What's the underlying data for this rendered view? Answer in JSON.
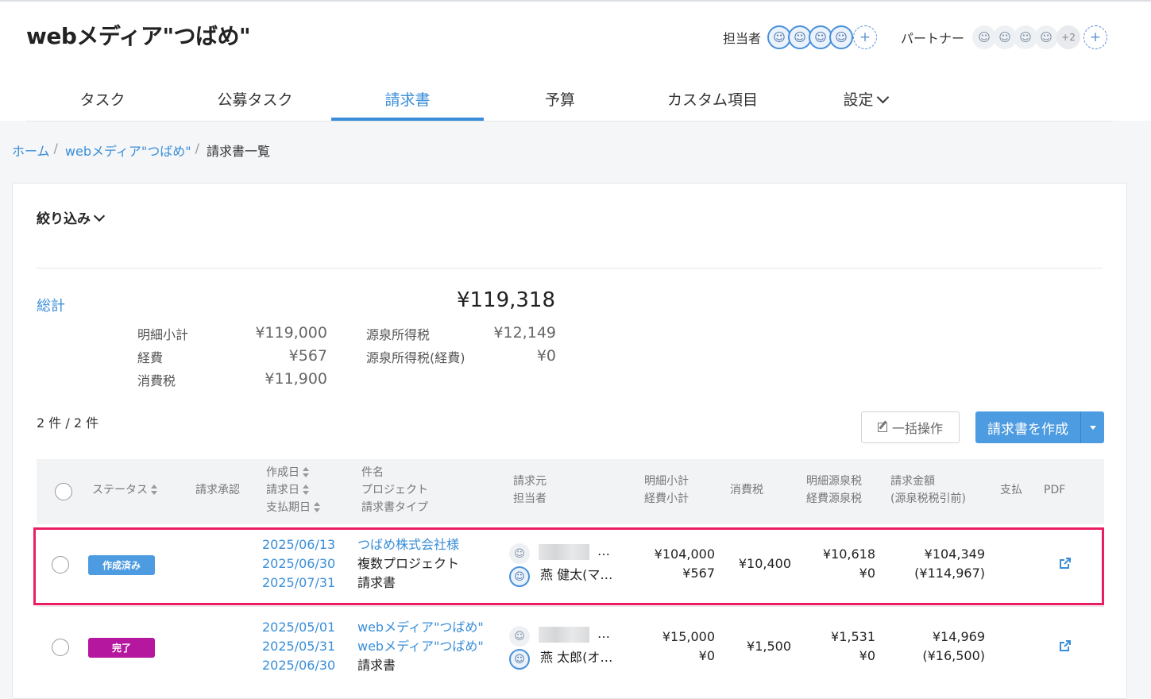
{
  "app": {
    "title": "webメディア\"つばめ\""
  },
  "team": {
    "members_label": "担当者",
    "partners_label": "パートナー",
    "member_avatars": [
      "☺",
      "☺",
      "☺",
      "☺"
    ],
    "partner_avatars": [
      "☺",
      "☺",
      "☺",
      "☺"
    ],
    "partner_more": "+2",
    "add_label": "+"
  },
  "nav": {
    "tabs": [
      {
        "label": "タスク"
      },
      {
        "label": "公募タスク"
      },
      {
        "label": "請求書"
      },
      {
        "label": "予算"
      },
      {
        "label": "カスタム項目"
      },
      {
        "label": "設定"
      }
    ],
    "active": "請求書"
  },
  "breadcrumb": {
    "home": "ホーム",
    "project": "webメディア\"つばめ\"",
    "current": "請求書一覧",
    "sep": "/"
  },
  "filter": {
    "label": "絞り込み"
  },
  "summary": {
    "total_label": "総計",
    "total": "¥119,318",
    "items": [
      {
        "label": "明細小計",
        "value": "¥119,000"
      },
      {
        "label": "経費",
        "value": "¥567"
      },
      {
        "label": "消費税",
        "value": "¥11,900"
      },
      {
        "label": "源泉所得税",
        "value": "¥12,149"
      },
      {
        "label": "源泉所得税(経費)",
        "value": "¥0"
      }
    ]
  },
  "list": {
    "count": "2 件 / 2 件",
    "bulk_button": "一括操作",
    "create_button": "請求書を作成"
  },
  "table": {
    "headers": {
      "status": "ステータス",
      "approval": "請求承認",
      "created": "作成日",
      "billed": "請求日",
      "due": "支払期日",
      "subject": "件名",
      "project": "プロジェクト",
      "type": "請求書タイプ",
      "from": "請求元",
      "assignee": "担当者",
      "subtotal": "明細小計",
      "expense": "経費小計",
      "tax": "消費税",
      "wh": "明細源泉税",
      "wh_exp": "経費源泉税",
      "amount": "請求金額",
      "amount_note": "(源泉税税引前)",
      "paid": "支払",
      "pdf": "PDF"
    },
    "rows": [
      {
        "status": "作成済み",
        "status_color": "#4d9be0",
        "created": "2025/06/13",
        "billed": "2025/06/30",
        "due": "2025/07/31",
        "subject": "つばめ株式会社様",
        "project": "複数プロジェクト",
        "type": "請求書",
        "from_suffix": "…",
        "assignee": "燕 健太(マ…",
        "subtotal": "¥104,000",
        "expense": "¥567",
        "tax": "¥10,400",
        "wh": "¥10,618",
        "wh_exp": "¥0",
        "amount": "¥104,349",
        "amount_gross": "(¥114,967)"
      },
      {
        "status": "完了",
        "status_color": "#b5179e",
        "created": "2025/05/01",
        "billed": "2025/05/31",
        "due": "2025/06/30",
        "subject": "webメディア\"つばめ\"",
        "project": "webメディア\"つばめ\"",
        "type": "請求書",
        "from_suffix": "…",
        "assignee": "燕 太郎(オ…",
        "subtotal": "¥15,000",
        "expense": "¥0",
        "tax": "¥1,500",
        "wh": "¥1,531",
        "wh_exp": "¥0",
        "amount": "¥14,969",
        "amount_gross": "(¥16,500)"
      }
    ]
  }
}
